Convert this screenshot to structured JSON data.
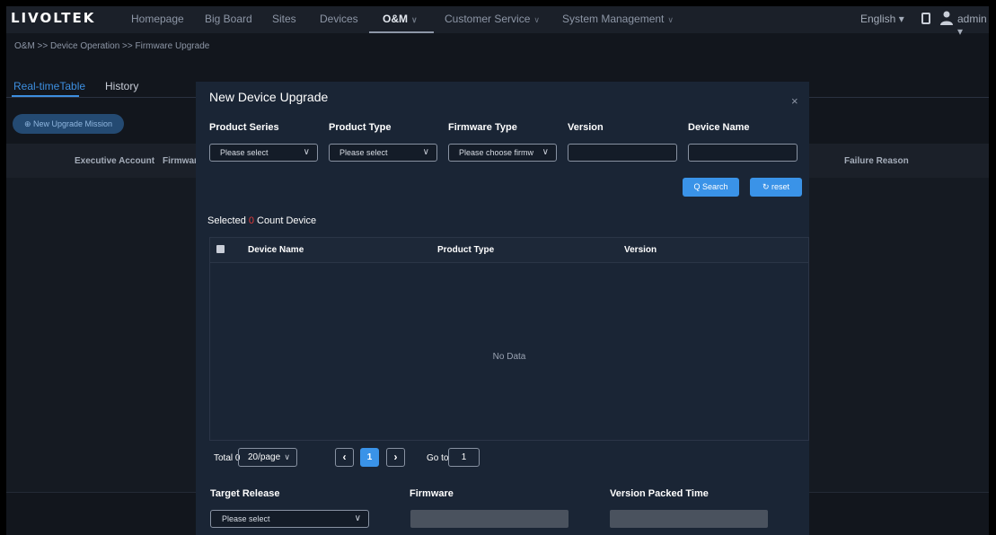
{
  "app": {
    "logo": "LIVOLTEK"
  },
  "nav": {
    "items": [
      {
        "label": "Homepage"
      },
      {
        "label": "Big Board"
      },
      {
        "label": "Sites"
      },
      {
        "label": "Devices"
      },
      {
        "label": "O&M"
      },
      {
        "label": "Customer Service"
      },
      {
        "label": "System Management"
      }
    ],
    "active": "O&M",
    "language": "English ▾",
    "user": "admin ▾"
  },
  "breadcrumb": "O&M >> Device Operation >> Firmware Upgrade",
  "page": {
    "tabs": [
      {
        "label": "Real-timeTable"
      },
      {
        "label": "History"
      }
    ],
    "new_mission_button": "⊕ New Upgrade Mission",
    "table_headers": [
      "Executive Account",
      "Firmwar",
      "Failure Reason"
    ]
  },
  "modal": {
    "title": "New Device Upgrade",
    "close": "×",
    "filters": {
      "product_series": {
        "label": "Product Series",
        "placeholder": "Please select"
      },
      "product_type": {
        "label": "Product Type",
        "placeholder": "Please select"
      },
      "firmware_type": {
        "label": "Firmware Type",
        "placeholder": "Please choose firmw"
      },
      "version": {
        "label": "Version",
        "value": ""
      },
      "device_name": {
        "label": "Device Name",
        "value": ""
      }
    },
    "search_button": "Q Search",
    "reset_button": "↻ reset",
    "selected": {
      "prefix": "Selected ",
      "count": "0",
      "suffix": " Count Device"
    },
    "table": {
      "headers": [
        "Device Name",
        "Product Type",
        "Version"
      ],
      "empty_text": "No Data"
    },
    "pagination": {
      "total": "Total 0",
      "page_size": "20/page",
      "prev": "‹",
      "current_page": "1",
      "next": "›",
      "goto_label": "Go to",
      "goto_value": "1"
    },
    "bottom": {
      "target_release": {
        "label": "Target Release",
        "placeholder": "Please select"
      },
      "firmware": {
        "label": "Firmware",
        "value": ""
      },
      "version_packed_time": {
        "label": "Version Packed Time",
        "value": ""
      }
    }
  },
  "colors": {
    "accent": "#3a93e8",
    "count_highlight": "#e23b3b",
    "modal_bg": "#1a2535"
  }
}
